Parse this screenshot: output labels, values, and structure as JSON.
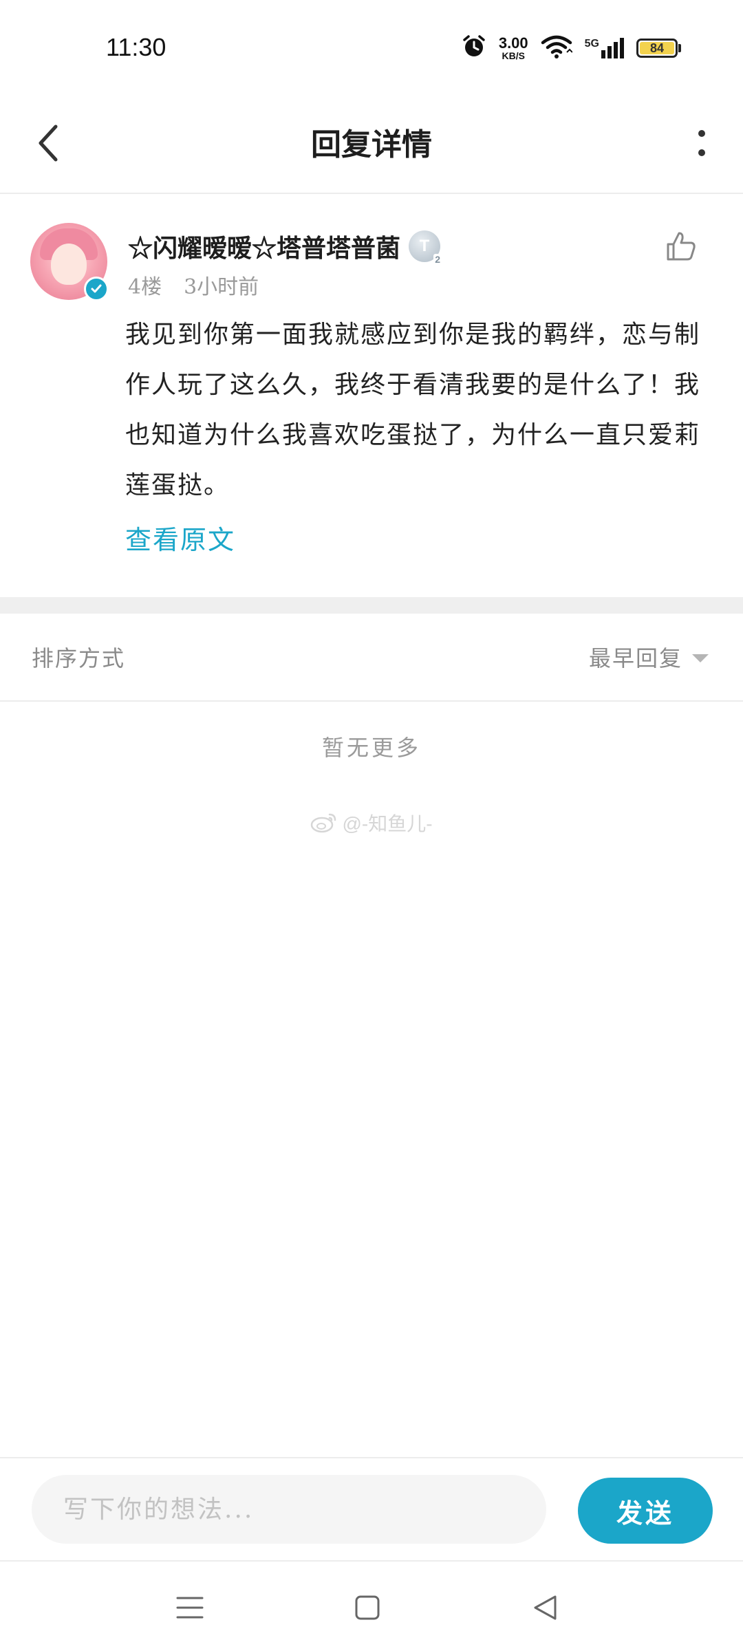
{
  "status_bar": {
    "time": "11:30",
    "net_speed_value": "3.00",
    "net_speed_unit": "KB/S",
    "network_type": "5G",
    "battery_level": "84",
    "icons": [
      "alarm-icon",
      "wifi-icon",
      "signal-icon",
      "battery-icon"
    ]
  },
  "header": {
    "title": "回复详情",
    "back_icon": "chevron-left-icon",
    "more_icon": "more-vertical-icon"
  },
  "post": {
    "username": "☆闪耀暧暧☆塔普塔普菌",
    "level_badge": "T",
    "level_number": "2",
    "floor": "4楼",
    "time_ago": "3小时前",
    "content": "我见到你第一面我就感应到你是我的羁绊，恋与制作人玩了这么久，我终于看清我要的是什么了！我也知道为什么我喜欢吃蛋挞了，为什么一直只爱莉莲蛋挞。",
    "view_original": "查看原文",
    "like_icon": "thumbs-up-icon"
  },
  "sort": {
    "label": "排序方式",
    "selected": "最早回复"
  },
  "empty_state": "暂无更多",
  "watermark": "@-知鱼儿-",
  "composer": {
    "placeholder": "写下你的想法...",
    "send_label": "发送"
  },
  "nav_bar": {
    "icons": [
      "menu-icon",
      "home-square-icon",
      "back-triangle-icon"
    ]
  },
  "colors": {
    "accent": "#1ba6c9",
    "battery": "#f3d24e"
  }
}
